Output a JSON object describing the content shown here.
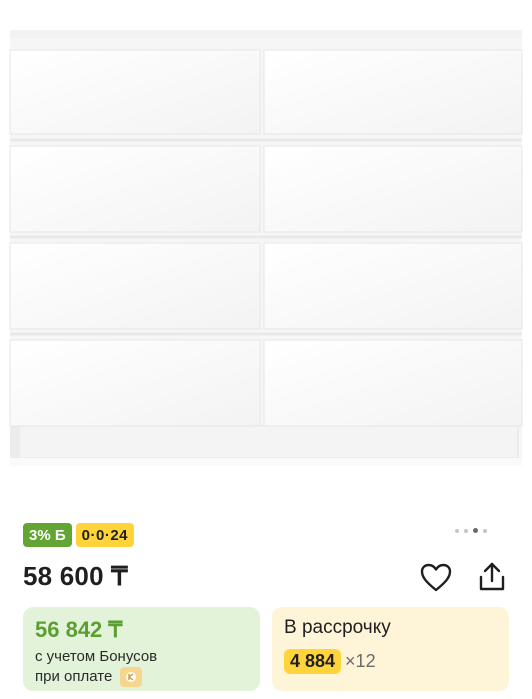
{
  "product": {
    "image_icon": "dresser-photo"
  },
  "badges": {
    "bonus": "3% Б",
    "installment": "0·0·24"
  },
  "gallery": {
    "total_pages": 4,
    "active_index": 2
  },
  "price": {
    "main": "58 600 ₸"
  },
  "actions": {
    "favorite_icon": "heart-icon",
    "share_icon": "share-icon"
  },
  "bonus_card": {
    "amount": "56 842 ₸",
    "note_line1": "с учетом Бонусов",
    "note_line2": "при оплате"
  },
  "installment_card": {
    "label": "В рассрочку",
    "amount": "4 884",
    "months": "×12"
  },
  "colors": {
    "bonus_green": "#62a534",
    "installment_yellow": "#ffd43b"
  }
}
